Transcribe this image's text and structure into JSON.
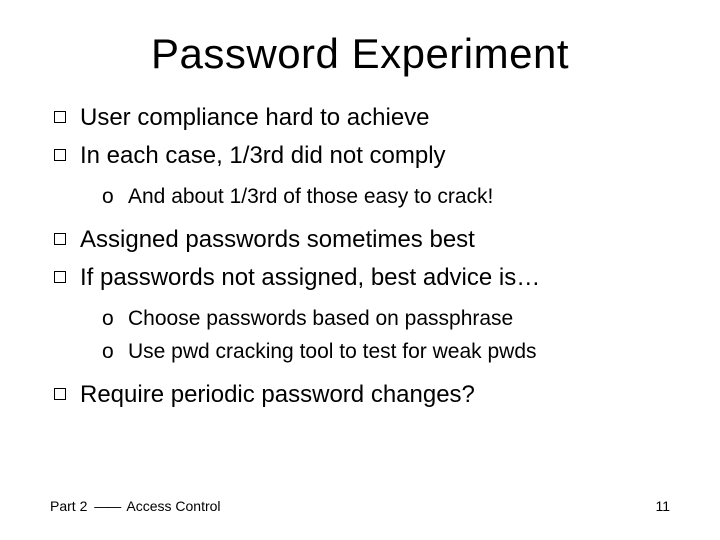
{
  "title": "Password Experiment",
  "bullets": {
    "b0": "User compliance hard to achieve",
    "b1": "In each case, 1/3rd did not comply",
    "b1_sub0": "And about 1/3rd of those easy to crack!",
    "b2": "Assigned passwords sometimes best",
    "b3": "If passwords not assigned, best advice is…",
    "b3_sub0": "Choose passwords based on passphrase",
    "b3_sub1": "Use pwd cracking tool to test for weak pwds",
    "b4": "Require periodic password changes?"
  },
  "footer": {
    "part": "Part 2",
    "sep": "——",
    "section": "Access Control"
  },
  "page": "11",
  "sub_marker": "o"
}
